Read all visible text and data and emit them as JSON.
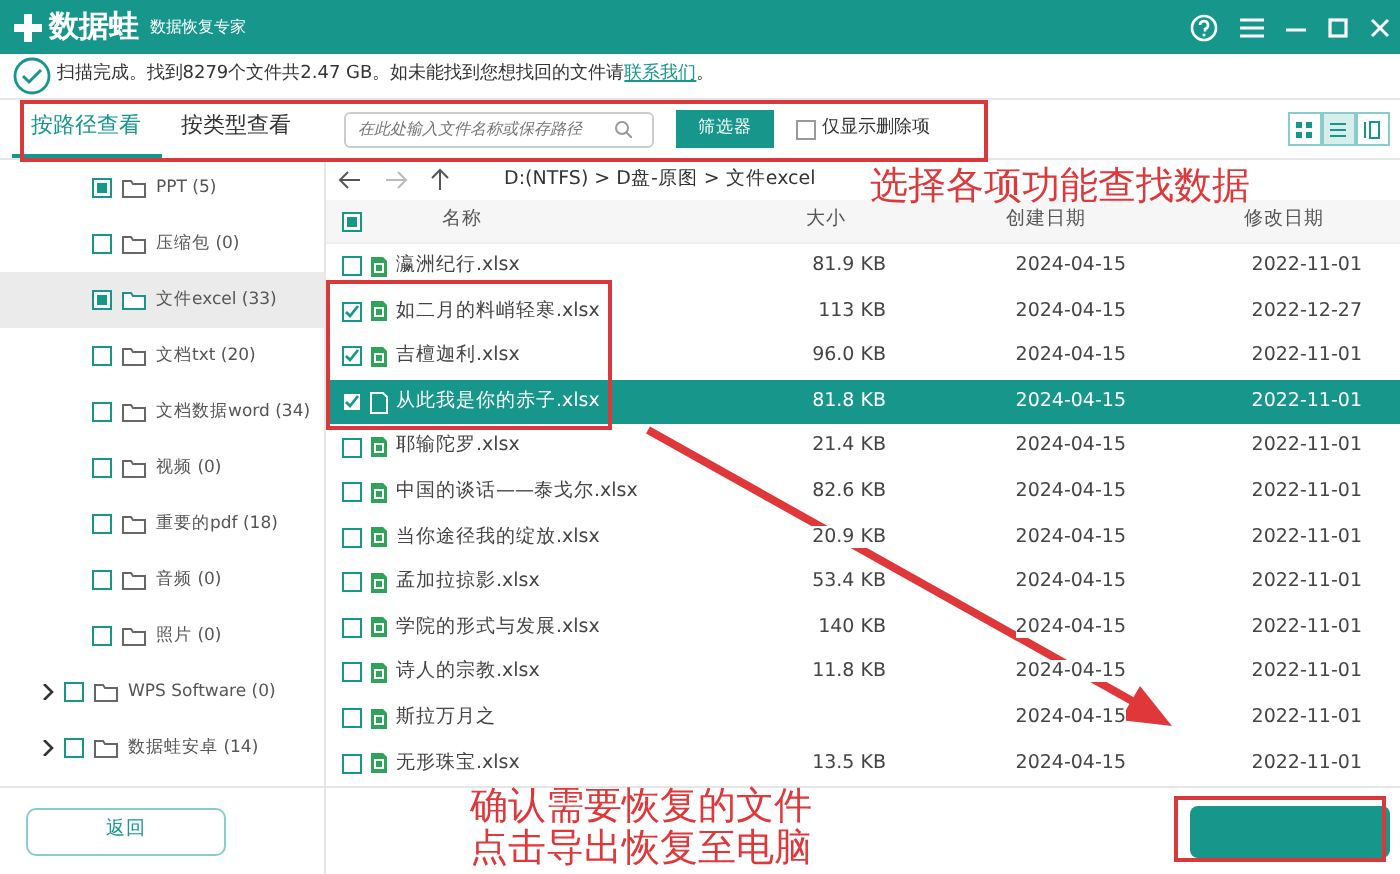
{
  "app": {
    "name": "数据蛙",
    "subtitle": "数据恢复专家"
  },
  "status": {
    "before": "扫描完成。找到8279个文件共2.47 GB。如未能找到您想找回的文件请",
    "link": "联系我们",
    "after": "。"
  },
  "tabs": [
    {
      "label": "按路径查看",
      "selected": true
    },
    {
      "label": "按类型查看",
      "selected": false
    }
  ],
  "search": {
    "placeholder": "在此处输入文件名称或保存路径"
  },
  "filter_button": "筛选器",
  "deleted_only": {
    "label": "仅显示删除项",
    "checked": false
  },
  "views": [
    {
      "kind": "grid",
      "selected": false
    },
    {
      "kind": "list",
      "selected": true
    },
    {
      "kind": "columns",
      "selected": false
    }
  ],
  "path": "D:(NTFS) > D盘-原图 > 文件excel",
  "tree": [
    {
      "label": "PPT (5)",
      "checked": true,
      "selected": false
    },
    {
      "label": "压缩包 (0)",
      "checked": false,
      "selected": false
    },
    {
      "label": "文件excel (33)",
      "checked": true,
      "selected": true
    },
    {
      "label": "文档txt (20)",
      "checked": false,
      "selected": false
    },
    {
      "label": "文档数据word (34)",
      "checked": false,
      "selected": false
    },
    {
      "label": "视频 (0)",
      "checked": false,
      "selected": false
    },
    {
      "label": "重要的pdf (18)",
      "checked": false,
      "selected": false
    },
    {
      "label": "音频 (0)",
      "checked": false,
      "selected": false
    },
    {
      "label": "照片 (0)",
      "checked": false,
      "selected": false
    },
    {
      "label": "WPS Software (0)",
      "checked": false,
      "selected": false,
      "expanded": false
    },
    {
      "label": "数据蛙安卓 (14)",
      "checked": false,
      "selected": false,
      "expanded": false
    }
  ],
  "back_button": "返回",
  "table": {
    "checked": true,
    "columns": [
      "名称",
      "大小",
      "创建日期",
      "修改日期"
    ],
    "rows": [
      {
        "name": "瀛洲纪行.xlsx",
        "size": "81.9 KB",
        "created": "2024-04-15",
        "modified": "2022-11-01",
        "checked": false,
        "selected": false
      },
      {
        "name": "如二月的料峭轻寒.xlsx",
        "size": "113 KB",
        "created": "2024-04-15",
        "modified": "2022-12-27",
        "checked": true,
        "selected": false
      },
      {
        "name": "吉檀迦利.xlsx",
        "size": "96.0 KB",
        "created": "2024-04-15",
        "modified": "2022-11-01",
        "checked": true,
        "selected": false
      },
      {
        "name": "从此我是你的赤子.xlsx",
        "size": "81.8 KB",
        "created": "2024-04-15",
        "modified": "2022-11-01",
        "checked": true,
        "selected": true
      },
      {
        "name": "耶输陀罗.xlsx",
        "size": "21.4 KB",
        "created": "2024-04-15",
        "modified": "2022-11-01",
        "checked": false,
        "selected": false
      },
      {
        "name": "中国的谈话——泰戈尔.xlsx",
        "size": "82.6 KB",
        "created": "2024-04-15",
        "modified": "2022-11-01",
        "checked": false,
        "selected": false
      },
      {
        "name": "当你途径我的绽放.xlsx",
        "size": "20.9 KB",
        "created": "2024-04-15",
        "modified": "2022-11-01",
        "checked": false,
        "selected": false
      },
      {
        "name": "孟加拉掠影.xlsx",
        "size": "53.4 KB",
        "created": "2024-04-15",
        "modified": "2022-11-01",
        "checked": false,
        "selected": false
      },
      {
        "name": "学院的形式与发展.xlsx",
        "size": "140 KB",
        "created": "2024-04-15",
        "modified": "2022-11-01",
        "checked": false,
        "selected": false
      },
      {
        "name": "诗人的宗教.xlsx",
        "size": "11.8 KB",
        "created": "2024-04-15",
        "modified": "2022-11-01",
        "checked": false,
        "selected": false
      },
      {
        "name": "斯拉万月之",
        "created": "2024-04-15",
        "modified": "2022-11-01",
        "checked": false,
        "selected": false
      },
      {
        "name": "无形珠宝.xlsx",
        "size": "13.5 KB",
        "created": "2024-04-15",
        "modified": "2022-11-01",
        "checked": false,
        "selected": false
      }
    ]
  },
  "annotations": [
    "选择各项功能查找数据",
    "确认需要恢复的文件",
    "点击导出恢复至电脑"
  ]
}
